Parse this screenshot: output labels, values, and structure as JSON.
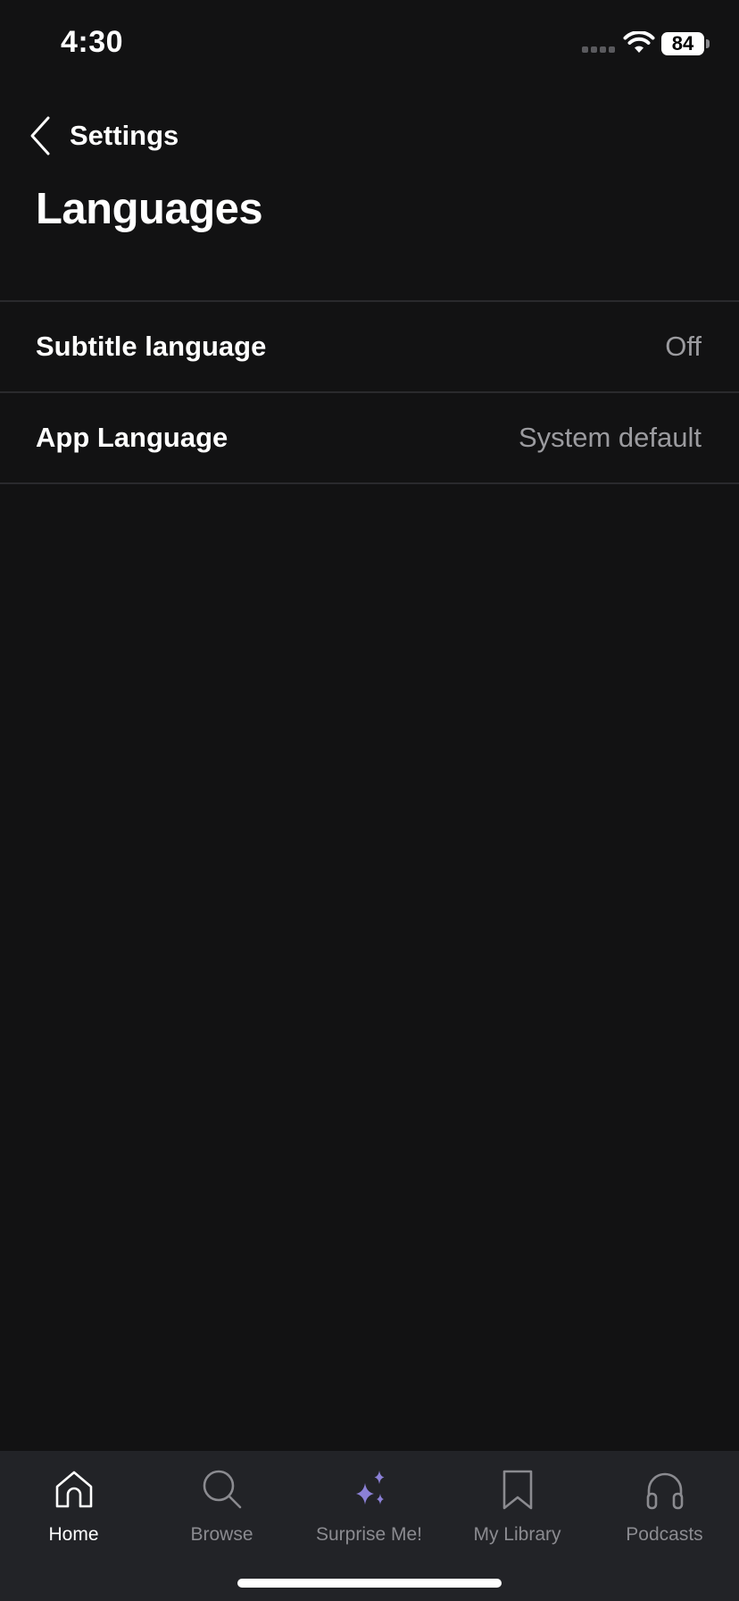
{
  "status_bar": {
    "time": "4:30",
    "battery": "84"
  },
  "header": {
    "back_label": "Settings",
    "title": "Languages"
  },
  "settings": [
    {
      "label": "Subtitle language",
      "value": "Off"
    },
    {
      "label": "App Language",
      "value": "System default"
    }
  ],
  "tab_bar": {
    "tabs": [
      {
        "label": "Home",
        "icon": "home-icon",
        "active": true
      },
      {
        "label": "Browse",
        "icon": "search-icon",
        "active": false
      },
      {
        "label": "Surprise Me!",
        "icon": "sparkle-icon",
        "active": false
      },
      {
        "label": "My Library",
        "icon": "bookmark-icon",
        "active": false
      },
      {
        "label": "Podcasts",
        "icon": "headphones-icon",
        "active": false
      }
    ]
  },
  "colors": {
    "background": "#121213",
    "tab_bar_background": "#222327",
    "divider": "#2a2a2d",
    "secondary_text": "#9b9b9f",
    "sparkle_accent": "#8b80d6"
  }
}
